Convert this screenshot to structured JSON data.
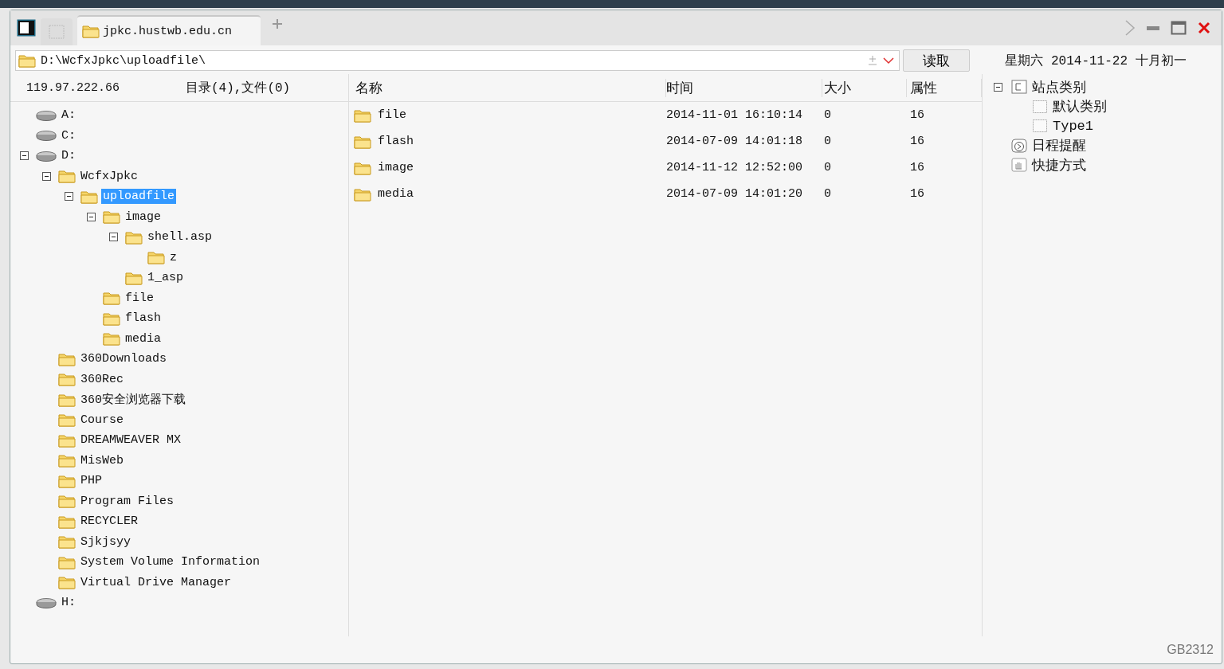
{
  "tabs": [
    {
      "label": "jpkc.hustwb.edu.cn",
      "selected": true
    }
  ],
  "address": {
    "value": "D:\\WcfxJpkc\\uploadfile\\"
  },
  "read_button": "读取",
  "date": "星期六 2014-11-22 十月初一",
  "server": "119.97.222.66",
  "summary": "目录(4),文件(0)",
  "tree": [
    {
      "label": "A:",
      "kind": "drive",
      "selected": false
    },
    {
      "label": "C:",
      "kind": "drive",
      "selected": false
    },
    {
      "label": "D:",
      "kind": "drive",
      "expanded": true,
      "selected": false,
      "children": [
        {
          "label": "WcfxJpkc",
          "kind": "folder",
          "expanded": true,
          "selected": false,
          "children": [
            {
              "label": "uploadfile",
              "kind": "folder",
              "expanded": true,
              "selected": true,
              "children": [
                {
                  "label": "image",
                  "kind": "folder",
                  "expanded": true,
                  "selected": false,
                  "children": [
                    {
                      "label": "shell.asp",
                      "kind": "folder",
                      "expanded": true,
                      "selected": false,
                      "children": [
                        {
                          "label": "z",
                          "kind": "folder",
                          "selected": false
                        }
                      ]
                    },
                    {
                      "label": "1_asp",
                      "kind": "folder",
                      "selected": false
                    }
                  ]
                },
                {
                  "label": "file",
                  "kind": "folder",
                  "selected": false
                },
                {
                  "label": "flash",
                  "kind": "folder",
                  "selected": false
                },
                {
                  "label": "media",
                  "kind": "folder",
                  "selected": false
                }
              ]
            }
          ]
        },
        {
          "label": "360Downloads",
          "kind": "folder",
          "selected": false
        },
        {
          "label": "360Rec",
          "kind": "folder",
          "selected": false
        },
        {
          "label": "360安全浏览器下载",
          "kind": "folder",
          "selected": false
        },
        {
          "label": "Course",
          "kind": "folder",
          "selected": false
        },
        {
          "label": "DREAMWEAVER MX",
          "kind": "folder",
          "selected": false
        },
        {
          "label": "MisWeb",
          "kind": "folder",
          "selected": false
        },
        {
          "label": "PHP",
          "kind": "folder",
          "selected": false
        },
        {
          "label": "Program Files",
          "kind": "folder",
          "selected": false
        },
        {
          "label": "RECYCLER",
          "kind": "folder",
          "selected": false
        },
        {
          "label": "Sjkjsyy",
          "kind": "folder",
          "selected": false
        },
        {
          "label": "System Volume Information",
          "kind": "folder",
          "selected": false
        },
        {
          "label": "Virtual Drive Manager",
          "kind": "folder",
          "selected": false
        }
      ]
    },
    {
      "label": "H:",
      "kind": "drive",
      "selected": false
    }
  ],
  "columns": [
    "名称",
    "时间",
    "大小",
    "属性"
  ],
  "rows": [
    {
      "name": "file",
      "time": "2014-11-01 16:10:14",
      "size": "0",
      "attr": "16"
    },
    {
      "name": "flash",
      "time": "2014-07-09 14:01:18",
      "size": "0",
      "attr": "16"
    },
    {
      "name": "image",
      "time": "2014-11-12 12:52:00",
      "size": "0",
      "attr": "16"
    },
    {
      "name": "media",
      "time": "2014-07-09 14:01:20",
      "size": "0",
      "attr": "16"
    }
  ],
  "sites": [
    {
      "label": "站点类别",
      "kind": "category",
      "expanded": true,
      "children": [
        {
          "label": "默认类别",
          "kind": "item"
        },
        {
          "label": "Type1",
          "kind": "item"
        }
      ]
    },
    {
      "label": "日程提醒",
      "kind": "schedule"
    },
    {
      "label": "快捷方式",
      "kind": "shortcut"
    }
  ],
  "encoding": "GB2312"
}
